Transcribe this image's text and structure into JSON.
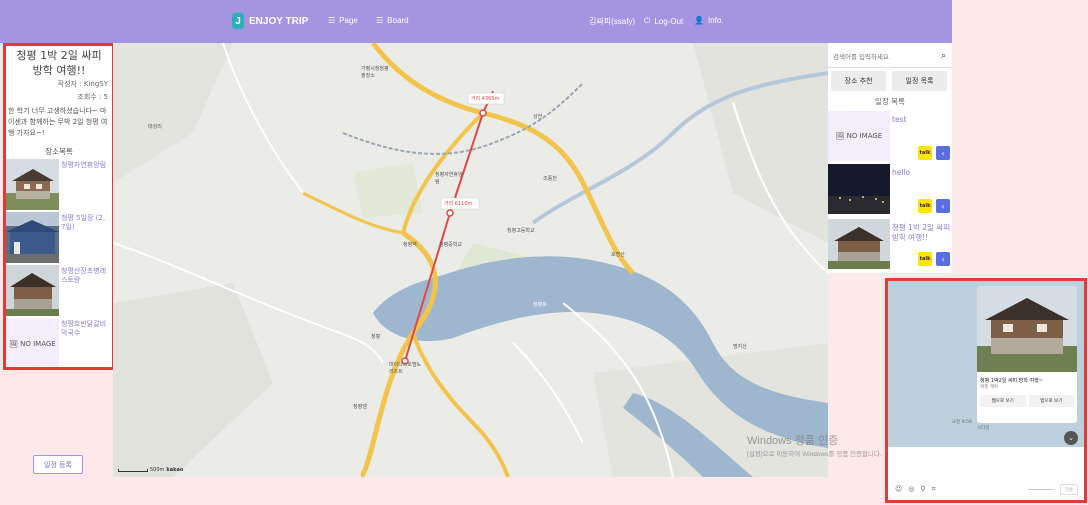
{
  "nav": {
    "brand": "ENJOY TRIP",
    "brand_icon": "J",
    "page": "Page",
    "board": "Board",
    "user": "김싸피(ssafy)",
    "logout": "Log-Out",
    "info": "Info."
  },
  "plan": {
    "title": "청평 1박 2일 싸피 방학 여행!!",
    "author": "작성자 : KingSY",
    "views": "조회수 : 5",
    "description": "한 학기 너무 고생하셨습니다~ 마이센과 함께하는 무박 2일 청평 여행 가자요~!",
    "places_heading": "장소목록",
    "places": [
      {
        "name": "청평자연휴양림"
      },
      {
        "name": "청평 5일장 (2, 7일)"
      },
      {
        "name": "청평산장초병레스토랑"
      },
      {
        "name": "청평호반닭갈비막국수",
        "image": "NO IMAGE"
      }
    ],
    "register_button": "일정 등록"
  },
  "map": {
    "distance_1": "거리 4365m",
    "distance_2": "거리 6110m",
    "scale": "500m",
    "provider": "kakao",
    "labels": [
      "가평시청청평출장소",
      "청평자연휴양림",
      "대성리",
      "청평역",
      "청평중학교",
      "청평고등학교",
      "청평호",
      "호명산",
      "조종천",
      "청평",
      "마이다스호텔&리조트",
      "상천",
      "청평댐",
      "명지산"
    ]
  },
  "search": {
    "placeholder": "검색어를 입력하세요"
  },
  "right": {
    "tab_recommend": "장소 추천",
    "tab_schedule": "일정 목록",
    "heading": "일정 목록",
    "items": [
      {
        "name": "test",
        "image": "NO IMAGE"
      },
      {
        "name": "hello"
      },
      {
        "name": "청평 1박 2일 싸피 방학 여행!!"
      }
    ],
    "kakao_label": "talk"
  },
  "chat": {
    "card_title": "청평 1박2일 싸피 방학 여행~",
    "card_sub": "여행 계획",
    "btn_web": "웹으로 보기",
    "btn_app": "앱으로 보기",
    "tag": "스타일",
    "time": "오전 9:59",
    "send": "전송"
  },
  "watermark": {
    "line1": "Windows 정품 인증",
    "line2": "[설정]으로 이동하여 Windows를 정품 인증합니다."
  }
}
